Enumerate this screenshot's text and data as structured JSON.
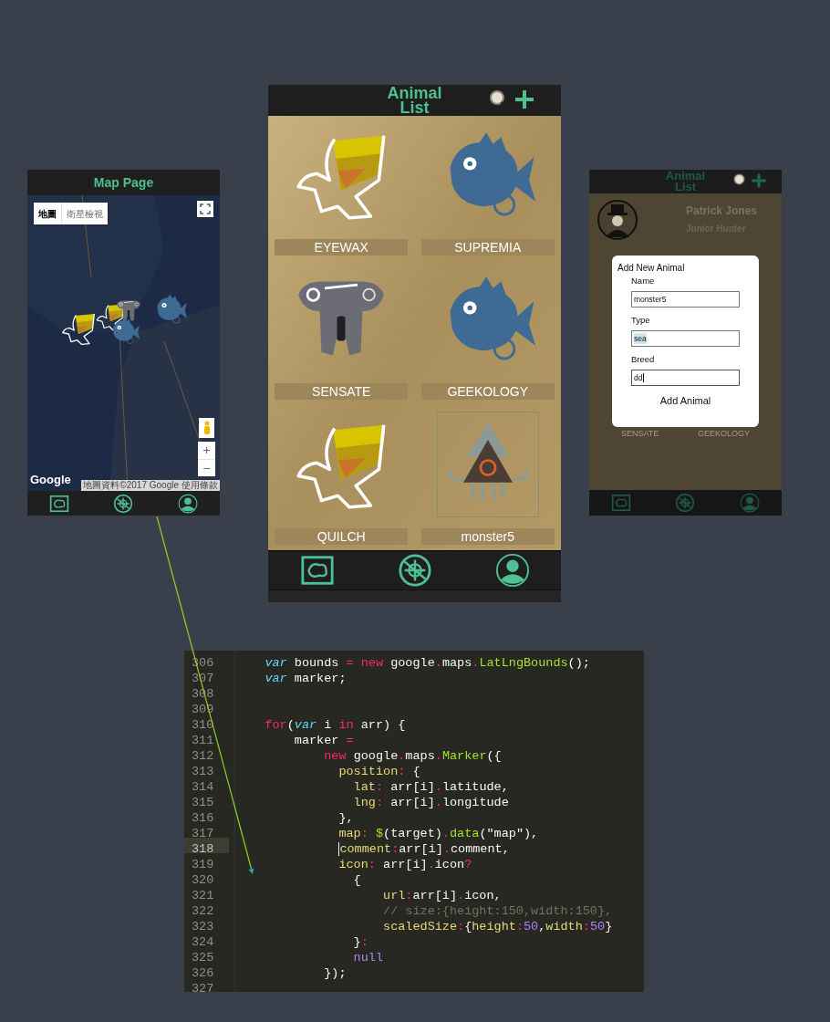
{
  "map_page": {
    "title": "Map Page",
    "map_types": [
      {
        "label": "地圖",
        "selected": true
      },
      {
        "label": "衛星檢視",
        "selected": false
      }
    ],
    "markers": [
      {
        "kind": "bird"
      },
      {
        "kind": "bird"
      },
      {
        "kind": "elephant"
      },
      {
        "kind": "fish"
      },
      {
        "kind": "fish"
      }
    ],
    "zoom_in": "+",
    "zoom_out": "−",
    "logo": "Google",
    "attribution": "地圖資料©2017 Google",
    "terms": "使用條款"
  },
  "animal_list": {
    "title": "Animal List",
    "animals": [
      {
        "name": "EYEWAX",
        "kind": "bird",
        "framed": false
      },
      {
        "name": "SUPREMIA",
        "kind": "fish",
        "framed": false
      },
      {
        "name": "SENSATE",
        "kind": "elephant",
        "framed": false
      },
      {
        "name": "GEEKOLOGY",
        "kind": "fish",
        "framed": false
      },
      {
        "name": "QUILCH",
        "kind": "bird",
        "framed": false
      },
      {
        "name": "monster5",
        "kind": "squid",
        "framed": true
      }
    ]
  },
  "add_animal_screen": {
    "title": "Animal List",
    "user": {
      "name": "Patrick Jones",
      "rank": "Junior Hunter"
    },
    "dialog": {
      "title": "Add New Animal",
      "fields": [
        {
          "label": "Name",
          "value": "monster5",
          "highlighted": false,
          "focused": false
        },
        {
          "label": "Type",
          "value": "sea",
          "highlighted": true,
          "focused": false
        },
        {
          "label": "Breed",
          "value": "dd",
          "highlighted": false,
          "focused": true
        }
      ],
      "button": "Add Animal"
    },
    "background_labels": [
      "SENSATE",
      "GEEKOLOGY"
    ]
  },
  "code_editor": {
    "lines": [
      {
        "number": "306",
        "current": false,
        "tokens": [
          {
            "text": "    var",
            "kind": "storage"
          },
          {
            "text": " bounds ",
            "kind": "plain"
          },
          {
            "text": "=",
            "kind": "keyword"
          },
          {
            "text": " new",
            "kind": "keyword"
          },
          {
            "text": " google",
            "kind": "plain"
          },
          {
            "text": ".",
            "kind": "keyword"
          },
          {
            "text": "maps",
            "kind": "plain"
          },
          {
            "text": ".",
            "kind": "keyword"
          },
          {
            "text": "LatLngBounds",
            "kind": "function"
          },
          {
            "text": "();",
            "kind": "plain"
          }
        ]
      },
      {
        "number": "307",
        "current": false,
        "tokens": [
          {
            "text": "    var",
            "kind": "storage"
          },
          {
            "text": " marker;",
            "kind": "plain"
          }
        ]
      },
      {
        "number": "308",
        "current": false
      },
      {
        "number": "309",
        "current": false
      },
      {
        "number": "310",
        "current": false,
        "tokens": [
          {
            "text": "    for",
            "kind": "keyword"
          },
          {
            "text": "(",
            "kind": "plain"
          },
          {
            "text": "var",
            "kind": "storage"
          },
          {
            "text": " i ",
            "kind": "plain"
          },
          {
            "text": "in",
            "kind": "keyword"
          },
          {
            "text": " arr) {",
            "kind": "plain"
          }
        ]
      },
      {
        "number": "311",
        "current": false,
        "tokens": [
          {
            "text": "        marker ",
            "kind": "plain"
          },
          {
            "text": "=",
            "kind": "keyword"
          }
        ]
      },
      {
        "number": "312",
        "current": false,
        "tokens": [
          {
            "text": "            new",
            "kind": "keyword"
          },
          {
            "text": " google",
            "kind": "plain"
          },
          {
            "text": ".",
            "kind": "keyword"
          },
          {
            "text": "maps",
            "kind": "plain"
          },
          {
            "text": ".",
            "kind": "keyword"
          },
          {
            "text": "Marker",
            "kind": "function"
          },
          {
            "text": "({",
            "kind": "plain"
          }
        ]
      },
      {
        "number": "313",
        "current": false,
        "tokens": [
          {
            "text": "              position",
            "kind": "property"
          },
          {
            "text": ":",
            "kind": "keyword"
          },
          {
            "text": " {",
            "kind": "plain"
          }
        ]
      },
      {
        "number": "314",
        "current": false,
        "tokens": [
          {
            "text": "                lat",
            "kind": "property"
          },
          {
            "text": ":",
            "kind": "keyword"
          },
          {
            "text": " arr[i]",
            "kind": "plain"
          },
          {
            "text": ".",
            "kind": "keyword"
          },
          {
            "text": "latitude,",
            "kind": "plain"
          }
        ]
      },
      {
        "number": "315",
        "current": false,
        "tokens": [
          {
            "text": "                lng",
            "kind": "property"
          },
          {
            "text": ":",
            "kind": "keyword"
          },
          {
            "text": " arr[i]",
            "kind": "plain"
          },
          {
            "text": ".",
            "kind": "keyword"
          },
          {
            "text": "longitude",
            "kind": "plain"
          }
        ]
      },
      {
        "number": "316",
        "current": false,
        "tokens": [
          {
            "text": "              },",
            "kind": "plain"
          }
        ]
      },
      {
        "number": "317",
        "current": false,
        "tokens": [
          {
            "text": "              map",
            "kind": "property"
          },
          {
            "text": ":",
            "kind": "keyword"
          },
          {
            "text": " $",
            "kind": "function"
          },
          {
            "text": "(target)",
            "kind": "plain"
          },
          {
            "text": ".",
            "kind": "keyword"
          },
          {
            "text": "data",
            "kind": "function"
          },
          {
            "text": "(\"map\"),",
            "kind": "plain"
          }
        ]
      },
      {
        "number": "318",
        "current": true,
        "tokens": [
          {
            "text": "              comment",
            "kind": "property"
          },
          {
            "text": ":",
            "kind": "keyword"
          },
          {
            "text": "arr[i]",
            "kind": "plain"
          },
          {
            "text": ".",
            "kind": "keyword"
          },
          {
            "text": "comment,",
            "kind": "plain"
          }
        ]
      },
      {
        "number": "319",
        "current": false,
        "tokens": [
          {
            "text": "              icon",
            "kind": "property"
          },
          {
            "text": ":",
            "kind": "keyword"
          },
          {
            "text": " arr[i]",
            "kind": "plain"
          },
          {
            "text": ".",
            "kind": "keyword"
          },
          {
            "text": "icon",
            "kind": "plain"
          },
          {
            "text": "?",
            "kind": "keyword"
          }
        ]
      },
      {
        "number": "320",
        "current": false,
        "tokens": [
          {
            "text": "                {",
            "kind": "plain"
          }
        ]
      },
      {
        "number": "321",
        "current": false,
        "tokens": [
          {
            "text": "                    url",
            "kind": "property"
          },
          {
            "text": ":",
            "kind": "keyword"
          },
          {
            "text": "arr[i]",
            "kind": "plain"
          },
          {
            "text": ".",
            "kind": "keyword"
          },
          {
            "text": "icon,",
            "kind": "plain"
          }
        ]
      },
      {
        "number": "322",
        "current": false,
        "tokens": [
          {
            "text": "                    // size:{height:150,width:150},",
            "kind": "comment"
          }
        ]
      },
      {
        "number": "323",
        "current": false,
        "tokens": [
          {
            "text": "                    scaledSize",
            "kind": "property"
          },
          {
            "text": ":",
            "kind": "keyword"
          },
          {
            "text": "{",
            "kind": "plain"
          },
          {
            "text": "height",
            "kind": "property"
          },
          {
            "text": ":",
            "kind": "keyword"
          },
          {
            "text": "50",
            "kind": "number"
          },
          {
            "text": ",",
            "kind": "plain"
          },
          {
            "text": "width",
            "kind": "property"
          },
          {
            "text": ":",
            "kind": "keyword"
          },
          {
            "text": "50",
            "kind": "number"
          },
          {
            "text": "}",
            "kind": "plain"
          }
        ]
      },
      {
        "number": "324",
        "current": false,
        "tokens": [
          {
            "text": "                }",
            "kind": "plain"
          },
          {
            "text": ":",
            "kind": "keyword"
          }
        ]
      },
      {
        "number": "325",
        "current": false,
        "tokens": [
          {
            "text": "                null",
            "kind": "constant"
          }
        ]
      },
      {
        "number": "326",
        "current": false,
        "tokens": [
          {
            "text": "            });",
            "kind": "plain"
          }
        ]
      },
      {
        "number": "327",
        "current": false
      }
    ]
  }
}
